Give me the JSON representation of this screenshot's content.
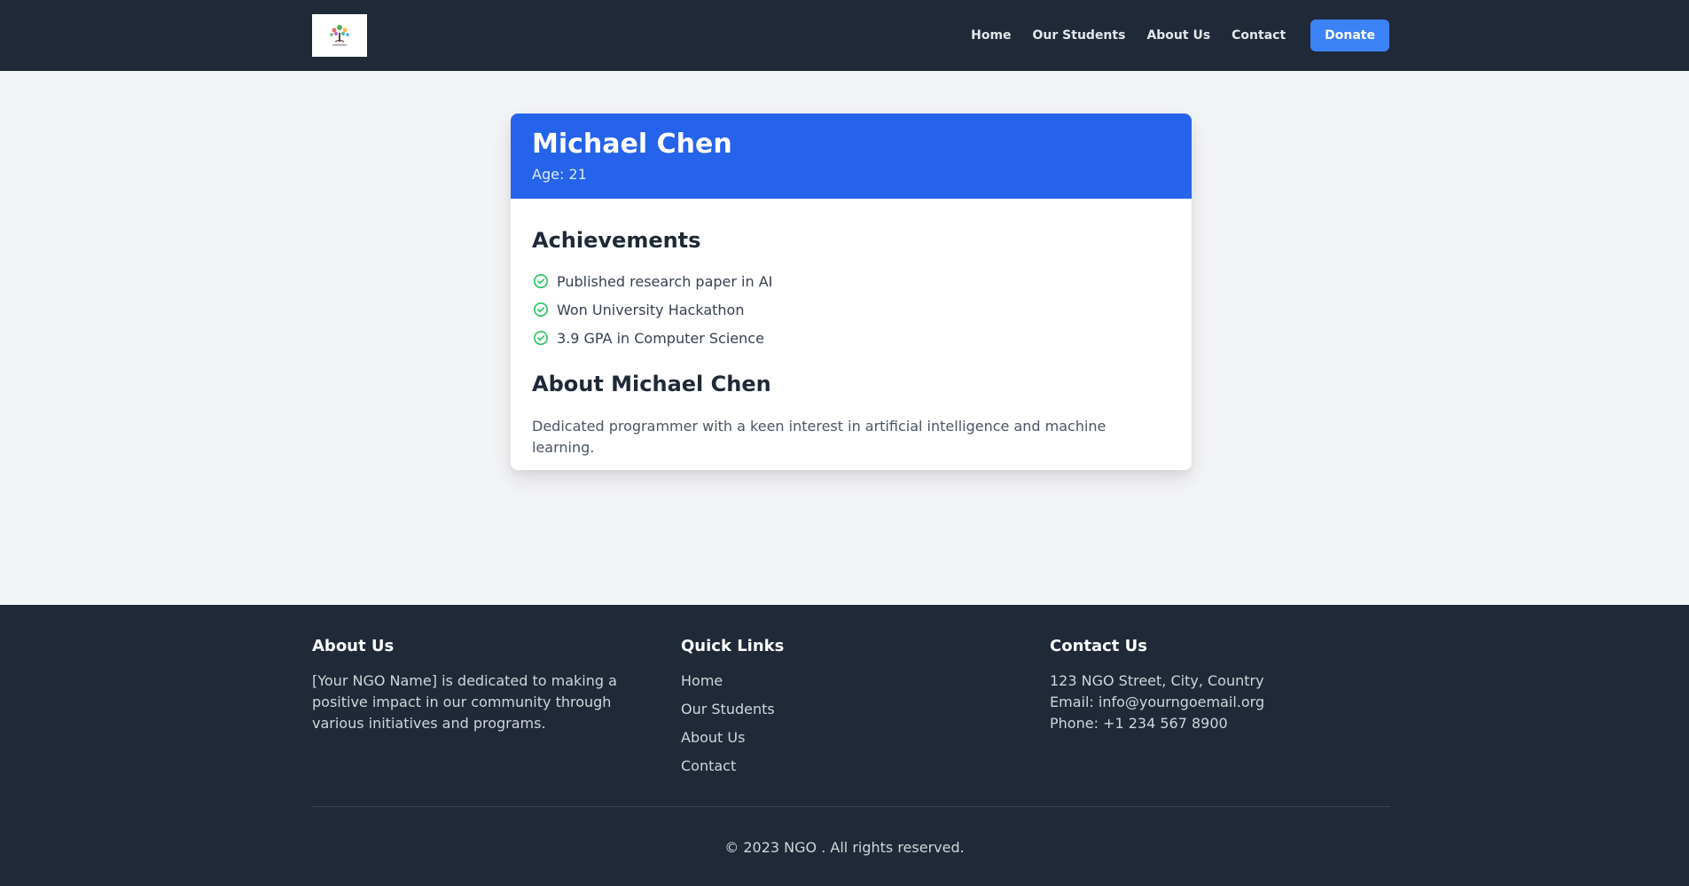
{
  "nav": {
    "logo_icon": "tree-logo-icon",
    "links": [
      "Home",
      "Our Students",
      "About Us",
      "Contact"
    ],
    "donate_label": "Donate"
  },
  "student": {
    "name": "Michael Chen",
    "age": "Age: 21",
    "achievements_title": "Achievements",
    "achievements": [
      "Published research paper in AI",
      "Won University Hackathon",
      "3.9 GPA in Computer Science"
    ],
    "about_title": "About Michael Chen",
    "about_text": "Dedicated programmer with a keen interest in artificial intelligence and machine learning."
  },
  "footer": {
    "about_title": "About Us",
    "about_text": "[Your NGO Name] is dedicated to making a positive impact in our community through various initiatives and programs.",
    "links_title": "Quick Links",
    "links": [
      "Home",
      "Our Students",
      "About Us",
      "Contact"
    ],
    "contact_title": "Contact Us",
    "address": "123 NGO Street, City, Country",
    "email": "Email: info@yourngoemail.org",
    "phone": "Phone: +1 234 567 8900",
    "copyright": "© 2023 NGO . All rights reserved."
  },
  "colors": {
    "nav_bg": "#1f2937",
    "accent": "#3b82f6",
    "card_header": "#2563eb",
    "check": "#22c55e"
  }
}
